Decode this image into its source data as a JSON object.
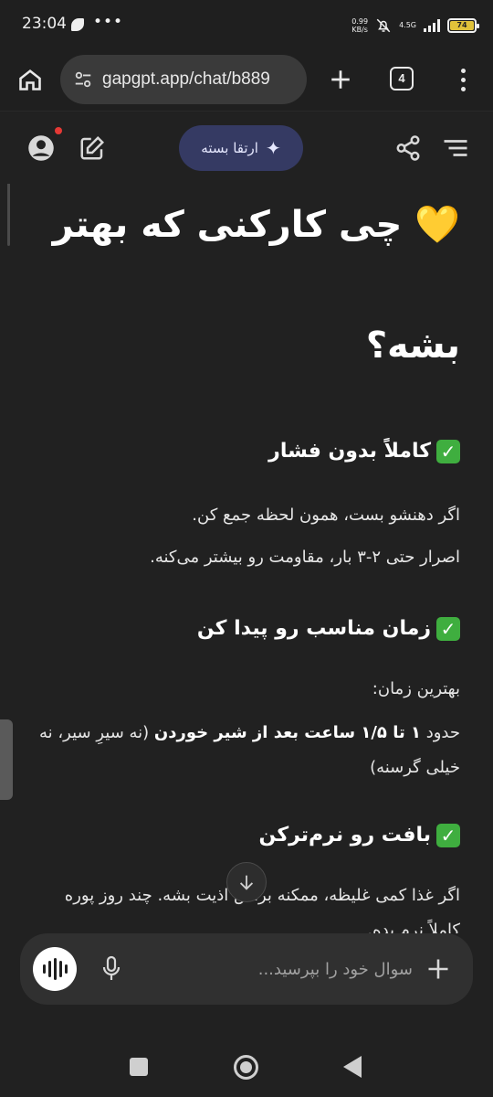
{
  "status_bar": {
    "time": "23:04",
    "dots": "•••",
    "net_speed_value": "0.99",
    "net_speed_unit": "KB/s",
    "network_label": "4.5G",
    "battery_level": "74"
  },
  "browser": {
    "url": "gapgpt.app/chat/b889",
    "tab_count": "4"
  },
  "header": {
    "upgrade_label": "ارتقا بسته"
  },
  "article": {
    "title_line1": "💛 چی کارکنی که بهتر",
    "title_line2": "بشه؟",
    "sections": [
      {
        "heading": "کاملاً بدون فشار",
        "lines": [
          "اگر دهنشو بست، همون لحظه جمع کن.",
          "اصرار حتی ۲-۳ بار، مقاومت رو بیشتر می‌کنه."
        ]
      },
      {
        "heading": "زمان مناسب رو پیدا کن",
        "intro": "بهترین زمان:",
        "para_prefix": "حدود ",
        "para_bold": "۱ تا ۱/۵ ساعت بعد از شیر خوردن",
        "para_suffix": " (نه سیرِ سیر، نه خیلی گرسنه)"
      },
      {
        "heading": "بافت رو نرم‌ترکن",
        "para": "اگر غذا کمی غلیظه، ممکنه براش اذیت بشه. چند روز پوره کاملاً نرم بده."
      }
    ]
  },
  "composer": {
    "placeholder": "سوال خود را بپرسید..."
  }
}
